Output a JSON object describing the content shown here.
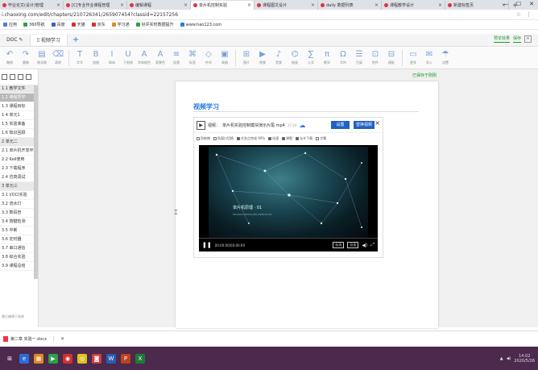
{
  "browser": {
    "tabs": [
      {
        "title": "毕业论文(设计)管理",
        "active": false
      },
      {
        "title": "[C]专业作业课程管理",
        "active": false
      },
      {
        "title": "编辑课程",
        "active": false
      },
      {
        "title": "单片机控制实验",
        "active": true
      },
      {
        "title": "课程图文设计",
        "active": false
      },
      {
        "title": "daily 数据列表",
        "active": false
      },
      {
        "title": "课程教学设计",
        "active": false
      },
      {
        "title": "新建标签页",
        "active": false
      }
    ],
    "new_tab": "+",
    "window_controls": [
      "—",
      "☐",
      "✕"
    ],
    "url": "i.chaoxing.com/edit/chapters/210726341/265907454?classid=22157256",
    "address_icons": [
      "☆",
      "⋮"
    ],
    "bookmarks": [
      {
        "label": "应用",
        "color": "#4a7be0"
      },
      {
        "label": "360导航",
        "color": "#2ca048"
      },
      {
        "label": "百度",
        "color": "#3b5fd0"
      },
      {
        "label": "天猫",
        "color": "#d03030"
      },
      {
        "label": "京东",
        "color": "#d03030"
      },
      {
        "label": "学习通",
        "color": "#e08a20"
      },
      {
        "label": "好评实时数据提升",
        "color": "#2ca048"
      },
      {
        "label": "www.hao123.com",
        "color": "#2b7be0"
      }
    ]
  },
  "app": {
    "doc_tabs": [
      {
        "label": "DOC",
        "active": false
      },
      {
        "label": "视频学习",
        "active": true
      }
    ],
    "add_tab": "+",
    "top_right": {
      "link1": "预览效果",
      "link2": "保存",
      "close": "×"
    },
    "toolbar_groups": [
      [
        {
          "glyph": "↶",
          "label": "撤销"
        },
        {
          "glyph": "↷",
          "label": "重做"
        },
        {
          "glyph": "▤",
          "label": "格式刷"
        },
        {
          "glyph": "⌫",
          "label": "清除"
        }
      ],
      [
        {
          "glyph": "T",
          "label": "字号"
        },
        {
          "glyph": "B",
          "label": "加粗"
        },
        {
          "glyph": "I",
          "label": "斜体"
        },
        {
          "glyph": "U",
          "label": "下划线"
        },
        {
          "glyph": "A",
          "label": "字体颜色"
        },
        {
          "glyph": "A",
          "label": "背景色"
        },
        {
          "glyph": "≡",
          "label": "段落"
        },
        {
          "glyph": "⌘",
          "label": "标签"
        },
        {
          "glyph": "◇",
          "label": "符号"
        },
        {
          "glyph": "▣",
          "label": "表格"
        }
      ],
      [
        {
          "glyph": "⊞",
          "label": "图片"
        },
        {
          "glyph": "▶",
          "label": "视频"
        },
        {
          "glyph": "♪",
          "label": "音频"
        },
        {
          "glyph": "⌬",
          "label": "链接"
        },
        {
          "glyph": "∑",
          "label": "公式"
        },
        {
          "glyph": "π",
          "label": "数学"
        },
        {
          "glyph": "Ω",
          "label": "字符"
        },
        {
          "glyph": "☰",
          "label": "目录"
        },
        {
          "glyph": "⊡",
          "label": "附件"
        },
        {
          "glyph": "⊟",
          "label": "模板"
        }
      ],
      [
        {
          "glyph": "▭",
          "label": "更多"
        },
        {
          "glyph": "✉",
          "label": "导入"
        },
        {
          "glyph": "☂",
          "label": "设置"
        }
      ]
    ],
    "sidebar": {
      "items": [
        {
          "label": "1.1 教学文件",
          "type": "head"
        },
        {
          "label": "1.2 课程导学",
          "type": "sel"
        },
        {
          "label": "1.3 课程目标",
          "type": "item"
        },
        {
          "label": "1.4 单元1",
          "type": "item"
        },
        {
          "label": "1.5 实验准备",
          "type": "item"
        },
        {
          "label": "1.6 知识回顾",
          "type": "item"
        },
        {
          "label": "2 单元二",
          "type": "head"
        },
        {
          "label": "2.1 单片机开发环境",
          "type": "item"
        },
        {
          "label": "2.2 Keil使用",
          "type": "item"
        },
        {
          "label": "2.3 下载程序",
          "type": "item"
        },
        {
          "label": "2.4 仿真调试",
          "type": "item"
        },
        {
          "label": "3 单元三",
          "type": "head"
        },
        {
          "label": "3.1 I/O口实验",
          "type": "item"
        },
        {
          "label": "3.2 流水灯",
          "type": "item"
        },
        {
          "label": "3.3 数码管",
          "type": "item"
        },
        {
          "label": "3.4 按键检测",
          "type": "item"
        },
        {
          "label": "3.5 中断",
          "type": "item"
        },
        {
          "label": "3.6 定时器",
          "type": "item"
        },
        {
          "label": "3.7 串口通信",
          "type": "item"
        },
        {
          "label": "3.8 综合实验",
          "type": "item"
        },
        {
          "label": "3.9 课程总结",
          "type": "item"
        }
      ],
      "bottom": "最后编辑于刚刚"
    },
    "saved_status": "已保存于刚刚",
    "section_title": "视频学习",
    "video_card": {
      "label": "视频：",
      "filename": "单片机实验控制模块演示片尾.mp4",
      "duration": "17:24",
      "btn_settings": "设置",
      "btn_replace": "替换视频",
      "close": "×",
      "options": [
        {
          "label": "防拖拽",
          "checked": false
        },
        {
          "label": "防窗口切换",
          "checked": false
        },
        {
          "label": "任务点完成 90%",
          "checked": true
        },
        {
          "label": "倍速",
          "checked": true
        },
        {
          "label": "弹题",
          "checked": true
        },
        {
          "label": "允许下载",
          "checked": true
        },
        {
          "label": "字幕",
          "checked": false
        }
      ],
      "video_title": "单片机原理 · 01",
      "video_subtitle": "MICROCONTROLLER PRINCIPLES",
      "controls": {
        "play": "❚❚",
        "time": "00:00:00/00:00:00",
        "quality": "标清",
        "speed": "倍速",
        "volume": "◀)",
        "fullscreen": "⤢"
      }
    }
  },
  "download_bar": {
    "item": "第二章 实验一.docx",
    "close": "✕"
  },
  "taskbar": {
    "apps": [
      {
        "glyph": "⊞",
        "color": "#4b2a4d"
      },
      {
        "glyph": "e",
        "color": "#2b6cd4"
      },
      {
        "glyph": "▦",
        "color": "#e08a20"
      },
      {
        "glyph": "▶",
        "color": "#2ca048"
      },
      {
        "glyph": "◉",
        "color": "#d03030"
      },
      {
        "glyph": "◎",
        "color": "#e0c020"
      },
      {
        "glyph": "◙",
        "color": "#d04040"
      },
      {
        "glyph": "W",
        "color": "#2b5cb0"
      },
      {
        "glyph": "P",
        "color": "#c04020"
      },
      {
        "glyph": "X",
        "color": "#1f7a3a"
      }
    ],
    "clock_time": "14:02",
    "clock_date": "2020/5/26"
  }
}
